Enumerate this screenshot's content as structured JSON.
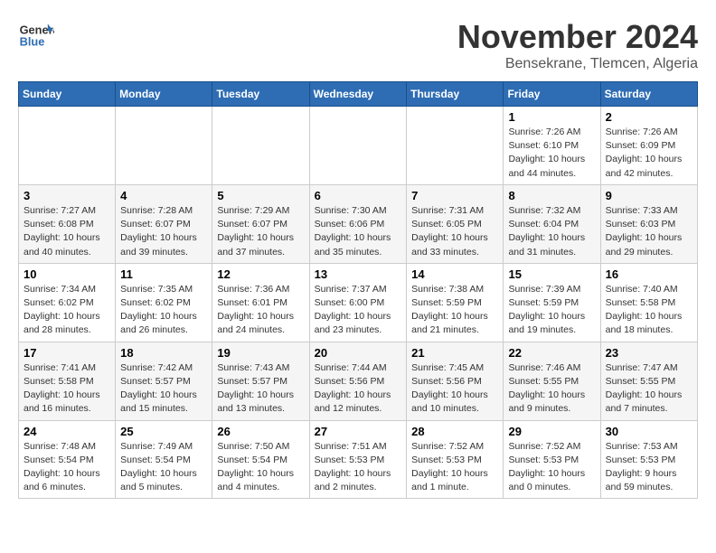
{
  "logo": {
    "general": "General",
    "blue": "Blue"
  },
  "title": "November 2024",
  "location": "Bensekrane, Tlemcen, Algeria",
  "days_of_week": [
    "Sunday",
    "Monday",
    "Tuesday",
    "Wednesday",
    "Thursday",
    "Friday",
    "Saturday"
  ],
  "weeks": [
    [
      {
        "day": "",
        "info": ""
      },
      {
        "day": "",
        "info": ""
      },
      {
        "day": "",
        "info": ""
      },
      {
        "day": "",
        "info": ""
      },
      {
        "day": "",
        "info": ""
      },
      {
        "day": "1",
        "info": "Sunrise: 7:26 AM\nSunset: 6:10 PM\nDaylight: 10 hours and 44 minutes."
      },
      {
        "day": "2",
        "info": "Sunrise: 7:26 AM\nSunset: 6:09 PM\nDaylight: 10 hours and 42 minutes."
      }
    ],
    [
      {
        "day": "3",
        "info": "Sunrise: 7:27 AM\nSunset: 6:08 PM\nDaylight: 10 hours and 40 minutes."
      },
      {
        "day": "4",
        "info": "Sunrise: 7:28 AM\nSunset: 6:07 PM\nDaylight: 10 hours and 39 minutes."
      },
      {
        "day": "5",
        "info": "Sunrise: 7:29 AM\nSunset: 6:07 PM\nDaylight: 10 hours and 37 minutes."
      },
      {
        "day": "6",
        "info": "Sunrise: 7:30 AM\nSunset: 6:06 PM\nDaylight: 10 hours and 35 minutes."
      },
      {
        "day": "7",
        "info": "Sunrise: 7:31 AM\nSunset: 6:05 PM\nDaylight: 10 hours and 33 minutes."
      },
      {
        "day": "8",
        "info": "Sunrise: 7:32 AM\nSunset: 6:04 PM\nDaylight: 10 hours and 31 minutes."
      },
      {
        "day": "9",
        "info": "Sunrise: 7:33 AM\nSunset: 6:03 PM\nDaylight: 10 hours and 29 minutes."
      }
    ],
    [
      {
        "day": "10",
        "info": "Sunrise: 7:34 AM\nSunset: 6:02 PM\nDaylight: 10 hours and 28 minutes."
      },
      {
        "day": "11",
        "info": "Sunrise: 7:35 AM\nSunset: 6:02 PM\nDaylight: 10 hours and 26 minutes."
      },
      {
        "day": "12",
        "info": "Sunrise: 7:36 AM\nSunset: 6:01 PM\nDaylight: 10 hours and 24 minutes."
      },
      {
        "day": "13",
        "info": "Sunrise: 7:37 AM\nSunset: 6:00 PM\nDaylight: 10 hours and 23 minutes."
      },
      {
        "day": "14",
        "info": "Sunrise: 7:38 AM\nSunset: 5:59 PM\nDaylight: 10 hours and 21 minutes."
      },
      {
        "day": "15",
        "info": "Sunrise: 7:39 AM\nSunset: 5:59 PM\nDaylight: 10 hours and 19 minutes."
      },
      {
        "day": "16",
        "info": "Sunrise: 7:40 AM\nSunset: 5:58 PM\nDaylight: 10 hours and 18 minutes."
      }
    ],
    [
      {
        "day": "17",
        "info": "Sunrise: 7:41 AM\nSunset: 5:58 PM\nDaylight: 10 hours and 16 minutes."
      },
      {
        "day": "18",
        "info": "Sunrise: 7:42 AM\nSunset: 5:57 PM\nDaylight: 10 hours and 15 minutes."
      },
      {
        "day": "19",
        "info": "Sunrise: 7:43 AM\nSunset: 5:57 PM\nDaylight: 10 hours and 13 minutes."
      },
      {
        "day": "20",
        "info": "Sunrise: 7:44 AM\nSunset: 5:56 PM\nDaylight: 10 hours and 12 minutes."
      },
      {
        "day": "21",
        "info": "Sunrise: 7:45 AM\nSunset: 5:56 PM\nDaylight: 10 hours and 10 minutes."
      },
      {
        "day": "22",
        "info": "Sunrise: 7:46 AM\nSunset: 5:55 PM\nDaylight: 10 hours and 9 minutes."
      },
      {
        "day": "23",
        "info": "Sunrise: 7:47 AM\nSunset: 5:55 PM\nDaylight: 10 hours and 7 minutes."
      }
    ],
    [
      {
        "day": "24",
        "info": "Sunrise: 7:48 AM\nSunset: 5:54 PM\nDaylight: 10 hours and 6 minutes."
      },
      {
        "day": "25",
        "info": "Sunrise: 7:49 AM\nSunset: 5:54 PM\nDaylight: 10 hours and 5 minutes."
      },
      {
        "day": "26",
        "info": "Sunrise: 7:50 AM\nSunset: 5:54 PM\nDaylight: 10 hours and 4 minutes."
      },
      {
        "day": "27",
        "info": "Sunrise: 7:51 AM\nSunset: 5:53 PM\nDaylight: 10 hours and 2 minutes."
      },
      {
        "day": "28",
        "info": "Sunrise: 7:52 AM\nSunset: 5:53 PM\nDaylight: 10 hours and 1 minute."
      },
      {
        "day": "29",
        "info": "Sunrise: 7:52 AM\nSunset: 5:53 PM\nDaylight: 10 hours and 0 minutes."
      },
      {
        "day": "30",
        "info": "Sunrise: 7:53 AM\nSunset: 5:53 PM\nDaylight: 9 hours and 59 minutes."
      }
    ]
  ]
}
